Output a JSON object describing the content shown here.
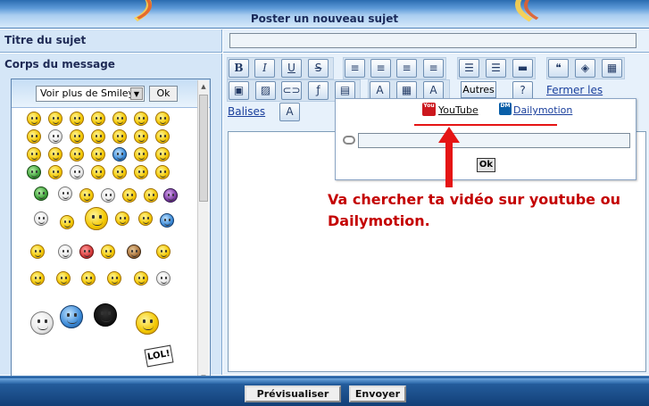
{
  "header": {
    "title": "Poster un nouveau sujet"
  },
  "form": {
    "subject_label": "Titre du sujet",
    "subject_value": "",
    "body_label": "Corps du message"
  },
  "smileys": {
    "select_value": "Voir plus de Smileys",
    "ok_label": "Ok",
    "sign_text": "LOL!"
  },
  "toolbar": {
    "bold": "B",
    "italic": "I",
    "underline": "U",
    "strike": "S",
    "autres_label": "Autres",
    "fermer_label": "Fermer les",
    "balises_label": "Balises"
  },
  "video_popup": {
    "youtube_label": "YouTube",
    "dailymotion_label": "Dailymotion",
    "youtube_logo": "You",
    "dailymotion_logo": "DM",
    "ok_label": "Ok"
  },
  "annotation": {
    "text": "Va chercher ta vidéo sur youtube ou Dailymotion.",
    "color": "#c40000"
  },
  "footer": {
    "preview_label": "Prévisualiser",
    "send_label": "Envoyer"
  }
}
